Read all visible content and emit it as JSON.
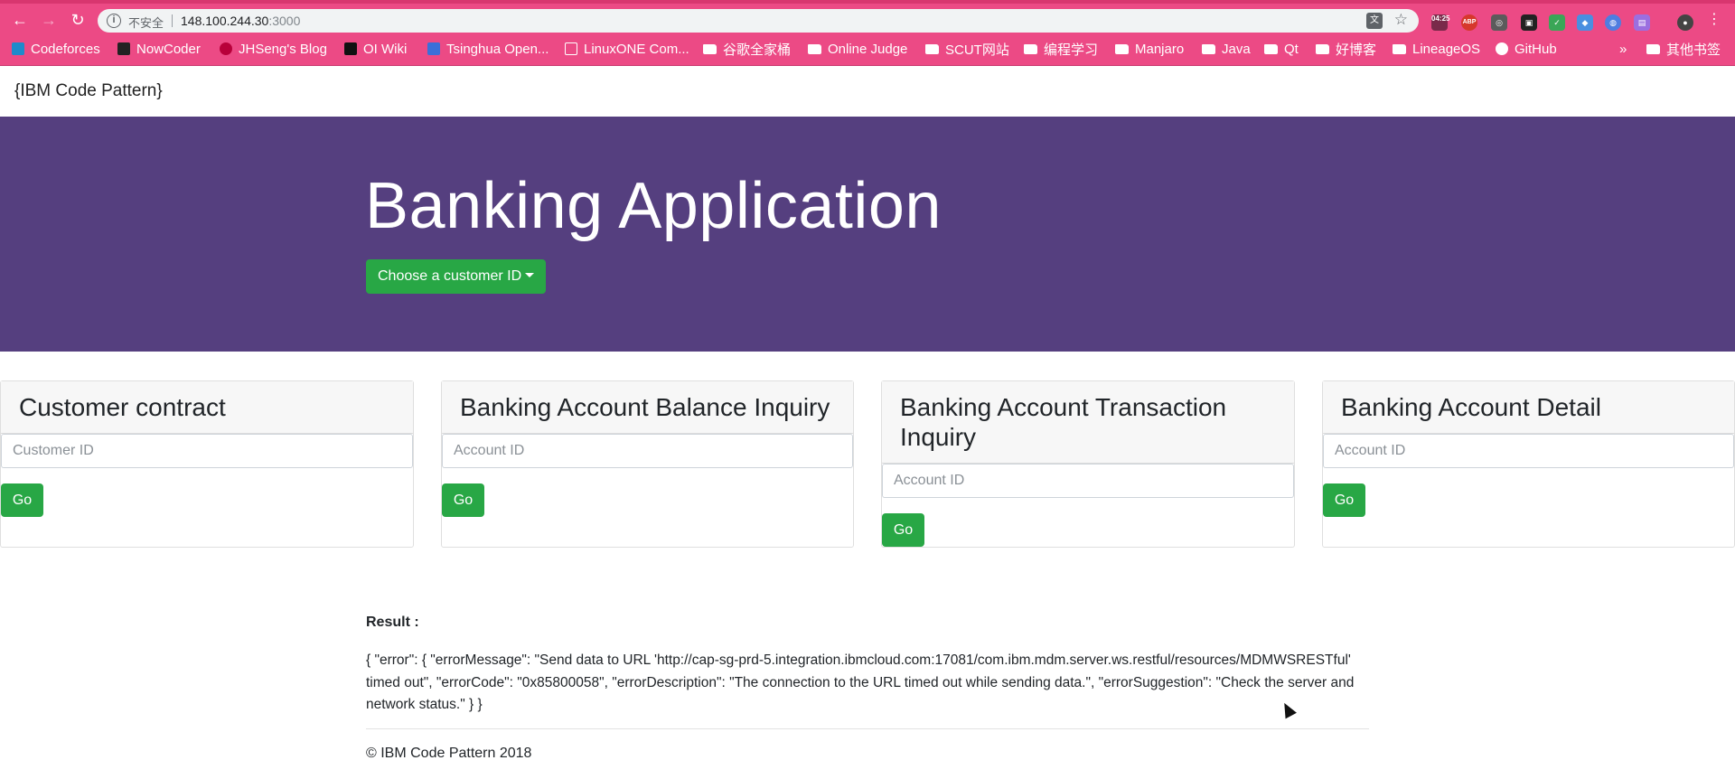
{
  "browser": {
    "security_label": "不安全",
    "url_host": "148.100.244.30",
    "url_port": ":3000",
    "bookmarks": [
      {
        "label": "Codeforces",
        "icon": "codeforces-icon"
      },
      {
        "label": "NowCoder",
        "icon": "nowcoder-icon"
      },
      {
        "label": "JHSeng's Blog",
        "icon": "blog-icon"
      },
      {
        "label": "OI Wiki",
        "icon": "oiwiki-icon"
      },
      {
        "label": "Tsinghua Open...",
        "icon": "tsinghua-icon"
      },
      {
        "label": "LinuxONE Com...",
        "icon": "page-icon"
      },
      {
        "label": "谷歌全家桶",
        "icon": "folder-icon"
      },
      {
        "label": "Online Judge",
        "icon": "folder-icon"
      },
      {
        "label": "SCUT网站",
        "icon": "folder-icon"
      },
      {
        "label": "编程学习",
        "icon": "folder-icon"
      },
      {
        "label": "Manjaro",
        "icon": "folder-icon"
      },
      {
        "label": "Java",
        "icon": "folder-icon"
      },
      {
        "label": "Qt",
        "icon": "folder-icon"
      },
      {
        "label": "好博客",
        "icon": "folder-icon"
      },
      {
        "label": "LineageOS",
        "icon": "folder-icon"
      },
      {
        "label": "GitHub",
        "icon": "github-icon"
      }
    ],
    "overflow_label": "»",
    "other_bookmarks": "其他书签",
    "ext_badge_1": "04:25",
    "ext_badge_2": "ABP"
  },
  "header": {
    "brand": "{IBM Code Pattern}"
  },
  "hero": {
    "title": "Banking Application",
    "dropdown_label": "Choose a customer ID"
  },
  "cards": [
    {
      "title": "Customer contract",
      "placeholder": "Customer ID",
      "button": "Go"
    },
    {
      "title": "Banking Account Balance Inquiry",
      "placeholder": "Account ID",
      "button": "Go"
    },
    {
      "title": "Banking Account Transaction Inquiry",
      "placeholder": "Account ID",
      "button": "Go"
    },
    {
      "title": "Banking Account Detail",
      "placeholder": "Account ID",
      "button": "Go"
    }
  ],
  "result": {
    "label": "Result :",
    "text": "{ \"error\": { \"errorMessage\": \"Send data to URL 'http://cap-sg-prd-5.integration.ibmcloud.com:17081/com.ibm.mdm.server.ws.restful/resources/MDMWSRESTful' timed out\", \"errorCode\": \"0x85800058\", \"errorDescription\": \"The connection to the URL timed out while sending data.\", \"errorSuggestion\": \"Check the server and network status.\" } }"
  },
  "footer": {
    "text": "© IBM Code Pattern 2018"
  },
  "colors": {
    "chrome": "#ec4a85",
    "hero": "#553f7f",
    "button": "#28a745"
  }
}
